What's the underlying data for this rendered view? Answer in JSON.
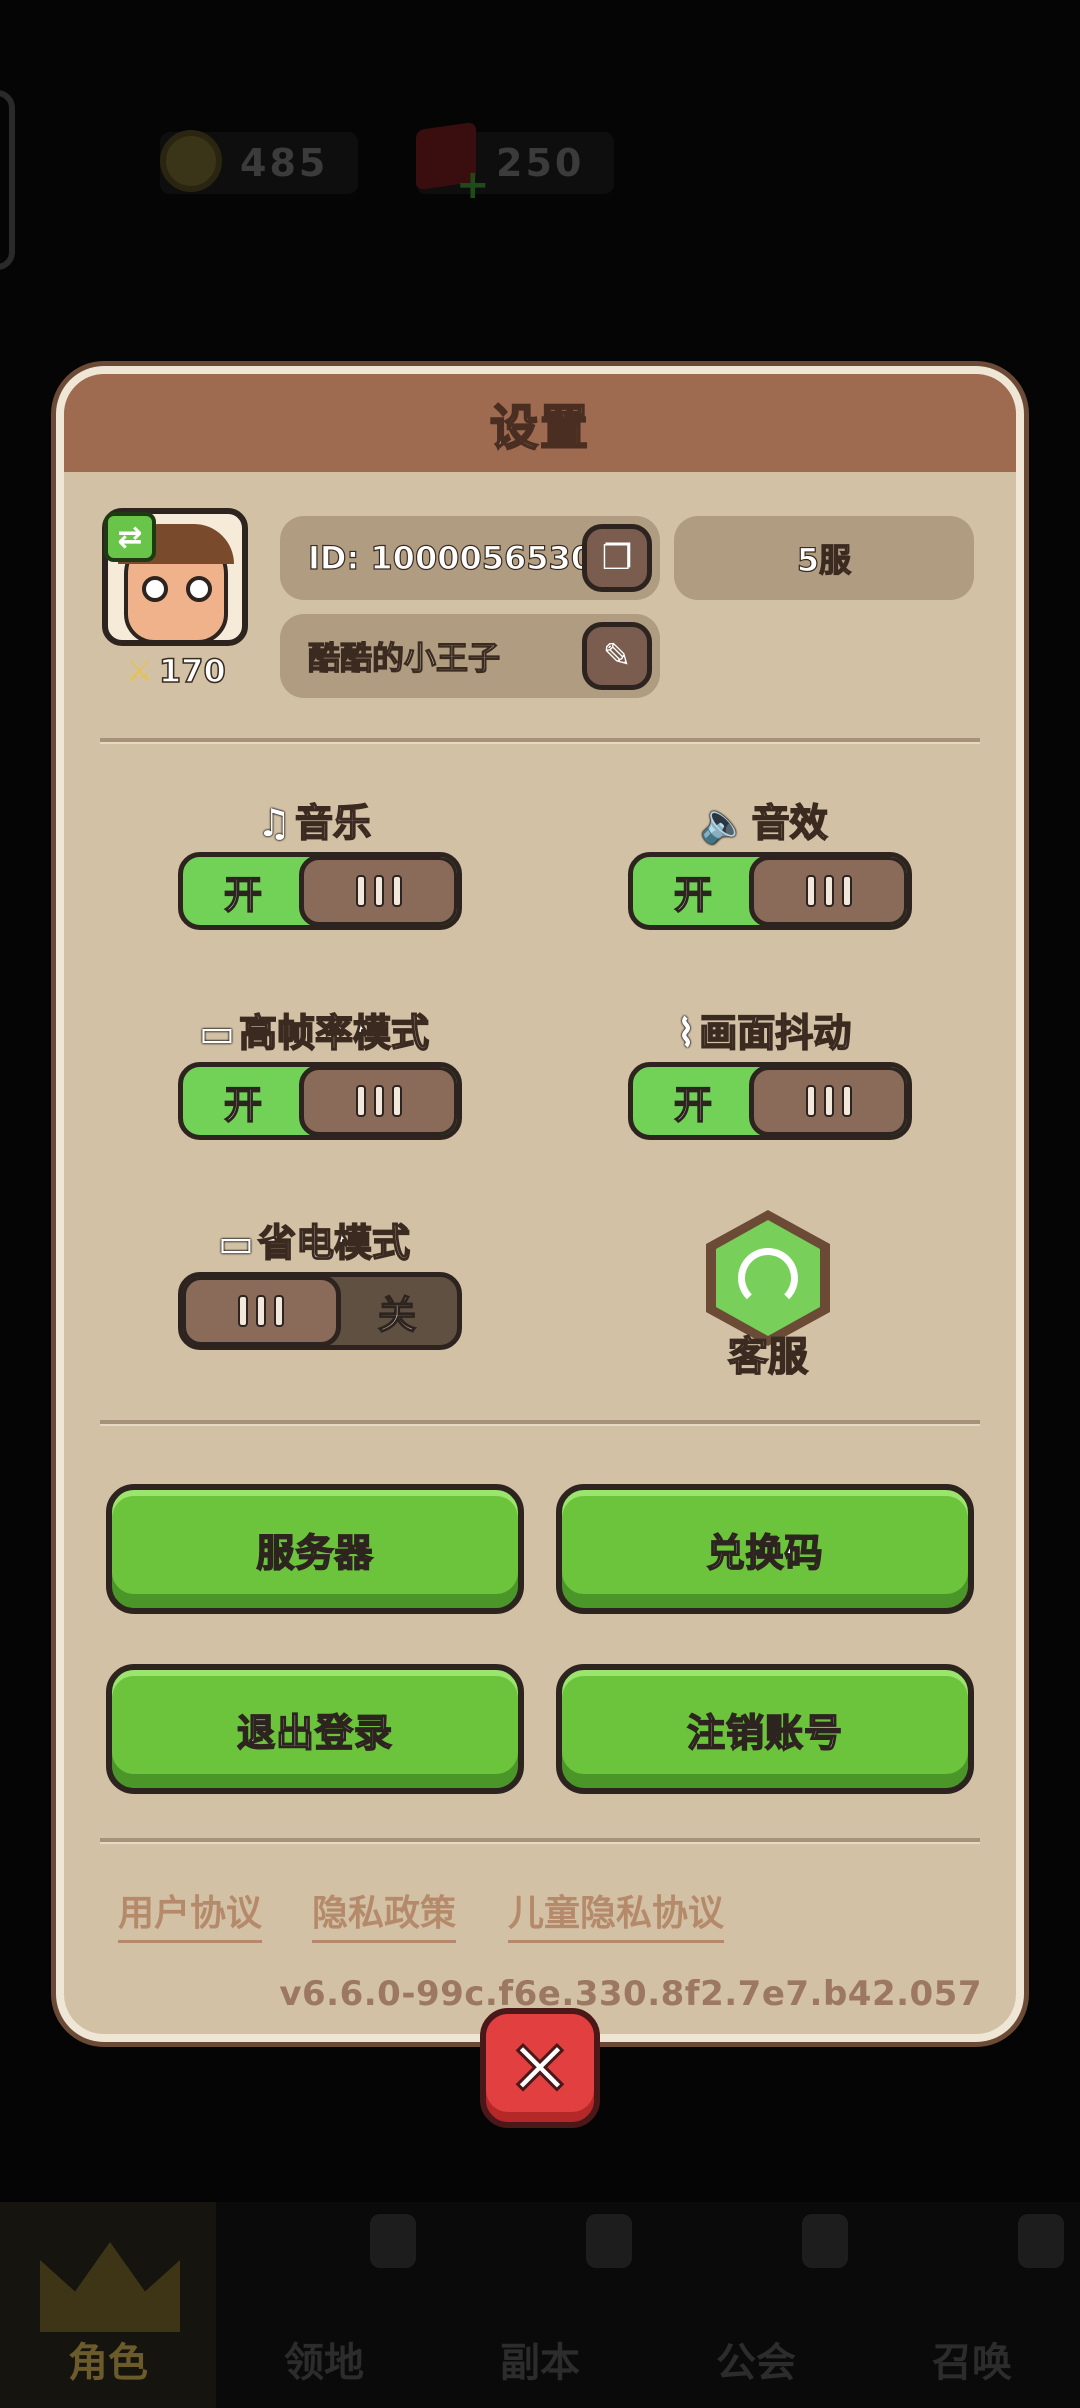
{
  "hud": {
    "coins": "485",
    "gems": "250",
    "gem_plus": "+"
  },
  "settings": {
    "title": "设置",
    "player": {
      "power": "170",
      "id_text": "ID: 1000056530",
      "server": "5服",
      "nickname": "酷酷的小王子",
      "swap_glyph": "⇄",
      "copy_glyph": "❐",
      "edit_glyph": "✎"
    },
    "options": {
      "music": {
        "icon": "♫",
        "label": "音乐",
        "state": "开"
      },
      "sfx": {
        "icon": "🔈",
        "label": "音效",
        "state": "开"
      },
      "high_fps": {
        "icon": "▭",
        "label": "高帧率模式",
        "state": "开"
      },
      "screen_shake": {
        "icon": "⌇",
        "label": "画面抖动",
        "state": "开"
      },
      "power_save": {
        "icon": "▭",
        "label": "省电模式",
        "state": "关"
      }
    },
    "customer_service": "客服",
    "buttons": {
      "server": "服务器",
      "redeem": "兑换码",
      "logout": "退出登录",
      "delete_account": "注销账号"
    },
    "links": {
      "user_agreement": "用户协议",
      "privacy_policy": "隐私政策",
      "child_privacy": "儿童隐私协议"
    },
    "version": "v6.6.0-99c.f6e.330.8f2.7e7.b42.057",
    "close_glyph": "✕"
  },
  "nav": {
    "tabs": [
      "角色",
      "领地",
      "副本",
      "公会",
      "召唤"
    ],
    "active_tab": "角色"
  }
}
